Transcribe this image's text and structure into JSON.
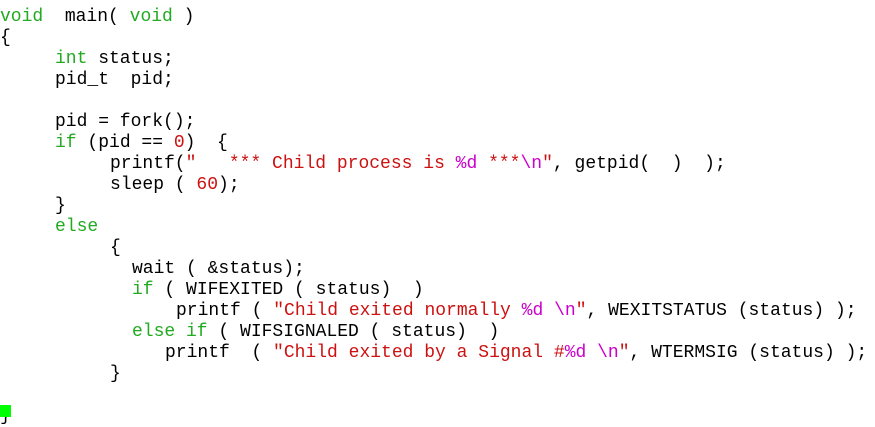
{
  "colors": {
    "background": "#ffffff",
    "text": "#000000",
    "keyword": "#22aa22",
    "string": "#cc1111",
    "format_specifier": "#cc00cc",
    "number": "#cc1111",
    "cursor": "#00ff00"
  },
  "lines": [
    {
      "indent": 0,
      "tokens": [
        {
          "t": "void",
          "c": "kw"
        },
        {
          "t": "  main( "
        },
        {
          "t": "void",
          "c": "kw"
        },
        {
          "t": " )"
        }
      ]
    },
    {
      "indent": 0,
      "tokens": [
        {
          "t": "{"
        }
      ]
    },
    {
      "indent": 55,
      "tokens": [
        {
          "t": "int",
          "c": "kw"
        },
        {
          "t": " status;"
        }
      ]
    },
    {
      "indent": 55,
      "tokens": [
        {
          "t": "pid_t  pid;"
        }
      ]
    },
    {
      "indent": 55,
      "tokens": []
    },
    {
      "indent": 55,
      "tokens": [
        {
          "t": "pid = fork();"
        }
      ]
    },
    {
      "indent": 55,
      "tokens": [
        {
          "t": "if",
          "c": "kw"
        },
        {
          "t": " (pid == "
        },
        {
          "t": "0",
          "c": "num"
        },
        {
          "t": ")  {"
        }
      ]
    },
    {
      "indent": 110,
      "tokens": [
        {
          "t": "printf("
        },
        {
          "t": "\"   *** Child process is ",
          "c": "str"
        },
        {
          "t": "%d",
          "c": "fmt"
        },
        {
          "t": " ***",
          "c": "str"
        },
        {
          "t": "\\n",
          "c": "fmt"
        },
        {
          "t": "\"",
          "c": "str"
        },
        {
          "t": ", getpid(  )  );"
        }
      ]
    },
    {
      "indent": 110,
      "tokens": [
        {
          "t": "sleep ( "
        },
        {
          "t": "60",
          "c": "num"
        },
        {
          "t": ");"
        }
      ]
    },
    {
      "indent": 55,
      "tokens": [
        {
          "t": "}"
        }
      ]
    },
    {
      "indent": 55,
      "tokens": [
        {
          "t": "else",
          "c": "kw"
        }
      ]
    },
    {
      "indent": 110,
      "tokens": [
        {
          "t": "{"
        }
      ]
    },
    {
      "indent": 132,
      "tokens": [
        {
          "t": "wait ( &status);"
        }
      ]
    },
    {
      "indent": 132,
      "tokens": [
        {
          "t": "if",
          "c": "kw"
        },
        {
          "t": " ( WIFEXITED ( status)  )"
        }
      ]
    },
    {
      "indent": 176,
      "tokens": [
        {
          "t": "printf ( "
        },
        {
          "t": "\"Child exited normally ",
          "c": "str"
        },
        {
          "t": "%d",
          "c": "fmt"
        },
        {
          "t": " ",
          "c": "str"
        },
        {
          "t": "\\n",
          "c": "fmt"
        },
        {
          "t": "\"",
          "c": "str"
        },
        {
          "t": ", WEXITSTATUS (status) );"
        }
      ]
    },
    {
      "indent": 132,
      "tokens": [
        {
          "t": "else if",
          "c": "kw"
        },
        {
          "t": " ( WIFSIGNALED ( status)  )"
        }
      ]
    },
    {
      "indent": 165,
      "tokens": [
        {
          "t": "printf  ( "
        },
        {
          "t": "\"Child exited by a Signal #",
          "c": "str"
        },
        {
          "t": "%d",
          "c": "fmt"
        },
        {
          "t": " ",
          "c": "str"
        },
        {
          "t": "\\n",
          "c": "fmt"
        },
        {
          "t": "\"",
          "c": "str"
        },
        {
          "t": ", WTERMSIG (status) );"
        }
      ]
    },
    {
      "indent": 110,
      "tokens": [
        {
          "t": "}"
        }
      ]
    },
    {
      "indent": 0,
      "tokens": []
    },
    {
      "indent": 0,
      "tokens": [
        {
          "t": "}"
        }
      ]
    }
  ]
}
